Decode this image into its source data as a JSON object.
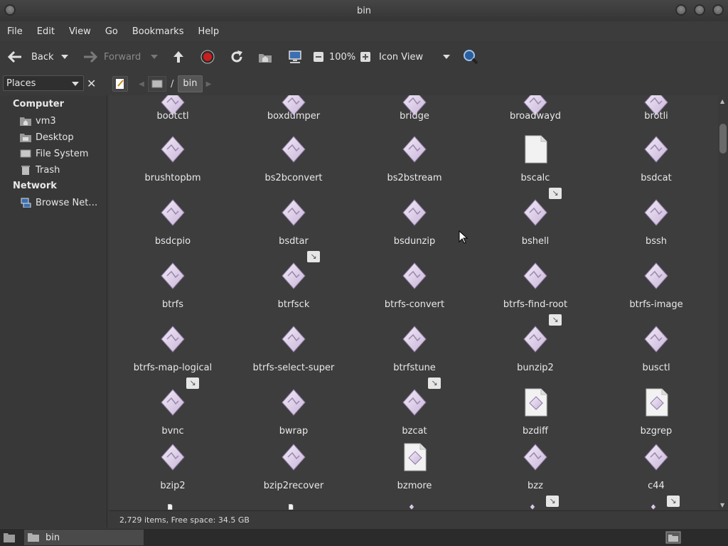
{
  "window": {
    "title": "bin"
  },
  "menu": [
    "File",
    "Edit",
    "View",
    "Go",
    "Bookmarks",
    "Help"
  ],
  "toolbar": {
    "back_label": "Back",
    "forward_label": "Forward",
    "zoom": "100%",
    "view_mode": "Icon View"
  },
  "sidebar": {
    "combo_label": "Places",
    "sections": [
      {
        "heading": "Computer",
        "items": [
          "vm3",
          "Desktop",
          "File System",
          "Trash"
        ]
      },
      {
        "heading": "Network",
        "items": [
          "Browse Net…"
        ]
      }
    ]
  },
  "location": {
    "separator": "/",
    "current": "bin"
  },
  "files": [
    "bootctl",
    "boxdumper",
    "bridge",
    "broadwayd",
    "brotli",
    "brushtopbm",
    "bs2bconvert",
    "bs2bstream",
    "bscalc",
    "bsdcat",
    "bsdcpio",
    "bsdtar",
    "bsdunzip",
    "bshell",
    "bssh",
    "btrfs",
    "btrfsck",
    "btrfs-convert",
    "btrfs-find-root",
    "btrfs-image",
    "btrfs-map-logical",
    "btrfs-select-super",
    "btrfstune",
    "bunzip2",
    "busctl",
    "bvnc",
    "bwrap",
    "bzcat",
    "bzdiff",
    "bzgrep",
    "bzip2",
    "bzip2recover",
    "bzmore",
    "bzz",
    "c44"
  ],
  "status": {
    "text": "2,729 items, Free space: 34.5 GB"
  },
  "taskbar": {
    "item_label": "bin"
  }
}
